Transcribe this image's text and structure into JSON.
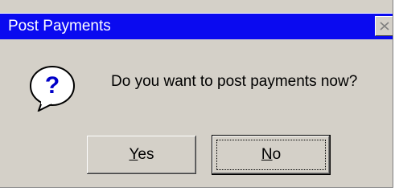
{
  "dialog": {
    "title": "Post Payments",
    "message": "Do you want to post payments now?",
    "icon": "question-icon",
    "buttons": {
      "yes": {
        "mnemonic": "Y",
        "rest": "es"
      },
      "no": {
        "mnemonic": "N",
        "rest": "o"
      }
    },
    "colors": {
      "titlebar": "#0a0af0",
      "face": "#d4d0c8"
    }
  }
}
